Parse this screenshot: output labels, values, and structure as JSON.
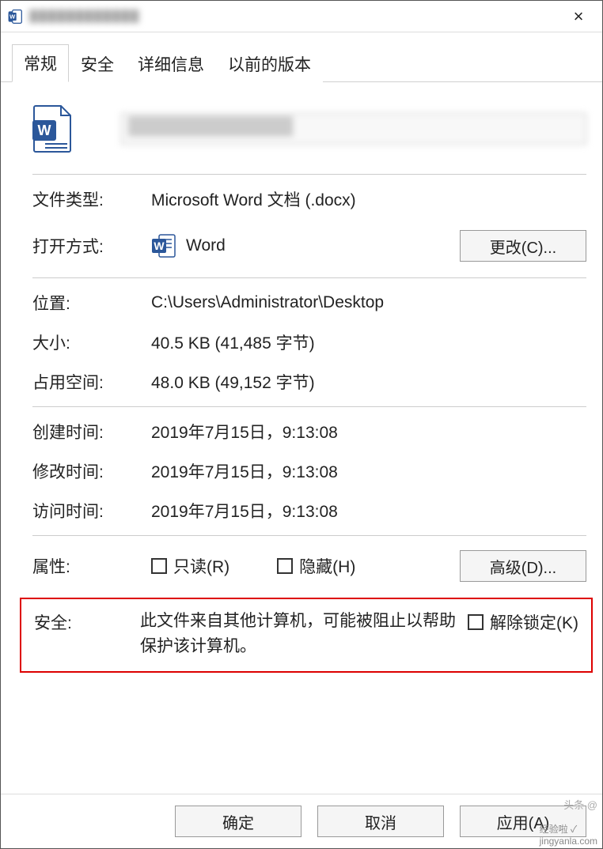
{
  "window": {
    "title_blurred": "████████████",
    "close_label": "×"
  },
  "tabs": [
    {
      "id": "general",
      "label": "常规",
      "active": true
    },
    {
      "id": "security",
      "label": "安全",
      "active": false
    },
    {
      "id": "details",
      "label": "详细信息",
      "active": false
    },
    {
      "id": "previous",
      "label": "以前的版本",
      "active": false
    }
  ],
  "file": {
    "name_blurred": "██████████████",
    "type_label": "文件类型:",
    "type_value": "Microsoft Word 文档 (.docx)",
    "open_with_label": "打开方式:",
    "open_with_app": "Word",
    "change_button": "更改(C)...",
    "location_label": "位置:",
    "location_value": "C:\\Users\\Administrator\\Desktop",
    "size_label": "大小:",
    "size_value": "40.5 KB (41,485 字节)",
    "disk_label": "占用空间:",
    "disk_value": "48.0 KB (49,152 字节)",
    "created_label": "创建时间:",
    "created_value": "2019年7月15日，9:13:08",
    "modified_label": "修改时间:",
    "modified_value": "2019年7月15日，9:13:08",
    "accessed_label": "访问时间:",
    "accessed_value": "2019年7月15日，9:13:08"
  },
  "attributes": {
    "label": "属性:",
    "readonly": "只读(R)",
    "hidden": "隐藏(H)",
    "advanced_button": "高级(D)..."
  },
  "security_zone": {
    "label": "安全:",
    "message": "此文件来自其他计算机，可能被阻止以帮助保护该计算机。",
    "unlock_label": "解除锁定(K)"
  },
  "buttons": {
    "ok": "确定",
    "cancel": "取消",
    "apply": "应用(A)"
  },
  "watermark": {
    "line1": "头条 @",
    "line2": "经验啦 ✓",
    "line3": "jingyanla.com"
  }
}
